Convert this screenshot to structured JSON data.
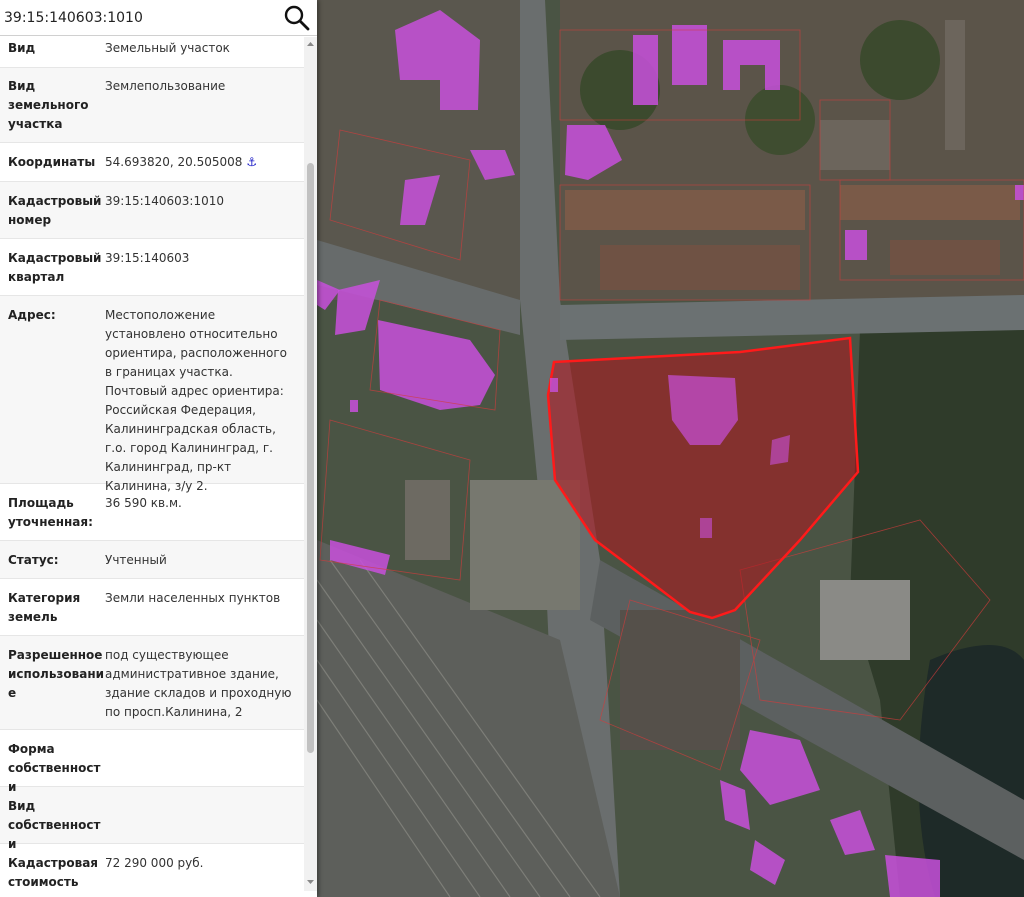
{
  "search": {
    "value": "39:15:140603:1010"
  },
  "details": [
    {
      "key": "Вид",
      "value": "Земельный участок"
    },
    {
      "key": "Вид земельного участка",
      "value": "Землепользование"
    },
    {
      "key": "Координаты",
      "value": "54.693820, 20.505008",
      "icon": "location-link-icon"
    },
    {
      "key": "Кадастровый номер",
      "value": "39:15:140603:1010"
    },
    {
      "key": "Кадастровый квартал",
      "value": "39:15:140603"
    },
    {
      "key": "Адрес:",
      "value": "Местоположение установлено относительно ориентира, расположенного в границах участка. Почтовый адрес ориентира: Российская Федерация, Калининградская область, г.о. город Калининград, г. Калининград, пр-кт Калинина, з/у 2."
    },
    {
      "key": "Площадь уточненная:",
      "value": "36 590 кв.м."
    },
    {
      "key": "Статус:",
      "value": "Учтенный"
    },
    {
      "key": "Категория земель",
      "value": "Земли населенных пунктов"
    },
    {
      "key": "Разрешенное использование",
      "value": "под существующее административное здание, здание складов и проходную по просп.Калинина, 2"
    },
    {
      "key": "Форма собственности",
      "value": ""
    },
    {
      "key": "Вид собственности",
      "value": ""
    },
    {
      "key": "Кадастровая стоимость",
      "value": "72 290 000 руб."
    }
  ],
  "colors": {
    "parcel_outline": "#ff1a1a",
    "parcel_fill": "#b4141e",
    "building_highlight": "#c850dc",
    "coord_icon": "#2323c8"
  }
}
